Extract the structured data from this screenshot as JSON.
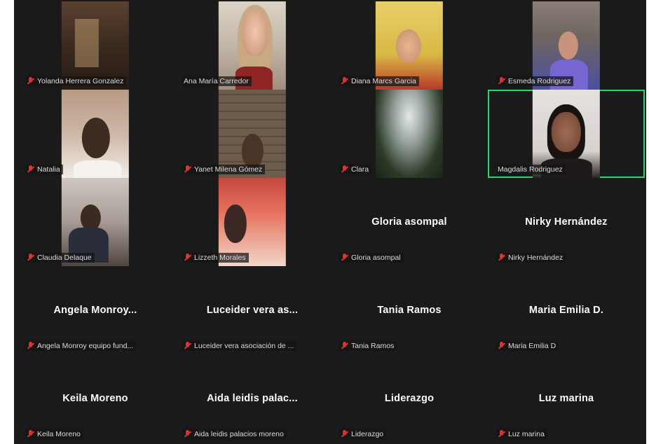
{
  "meeting": {
    "participants": [
      {
        "name": "Yolanda Herrera Gonzalez",
        "display": "",
        "video": "room",
        "muted": true
      },
      {
        "name": "Ana María Carredor",
        "display": "",
        "video": "office",
        "muted": false
      },
      {
        "name": "Diana Marcs Garcia",
        "display": "",
        "video": "yellow",
        "muted": true
      },
      {
        "name": "Esmeda Rodriguez",
        "display": "",
        "video": "blue",
        "muted": true
      },
      {
        "name": "Natalia",
        "display": "",
        "video": "natalia",
        "muted": true
      },
      {
        "name": "Yanet Milena Gómez",
        "display": "",
        "video": "brick",
        "muted": true
      },
      {
        "name": "Clara",
        "display": "",
        "video": "tree",
        "muted": true
      },
      {
        "name": "Magdalis Rodriguez",
        "display": "",
        "video": "magda",
        "muted": false,
        "active_speaker": true
      },
      {
        "name": "Claudia Delaque",
        "display": "",
        "video": "claudia",
        "muted": true
      },
      {
        "name": "Lizzeth Morales",
        "display": "",
        "video": "laura",
        "muted": true
      },
      {
        "name": "Gloria asompal",
        "display": "Gloria asompal",
        "video": "",
        "muted": true
      },
      {
        "name": "Nirky Hernández",
        "display": "Nirky Hernández",
        "video": "",
        "muted": true
      },
      {
        "name": "Angela Monroy equipo fund...",
        "display": "Angela  Monroy...",
        "video": "",
        "muted": true
      },
      {
        "name": "Luceider vera asociación de ...",
        "display": "Luceider vera as...",
        "video": "",
        "muted": true
      },
      {
        "name": "Tania Ramos",
        "display": "Tania Ramos",
        "video": "",
        "muted": true
      },
      {
        "name": "Maria Emilia D",
        "display": "Maria Emilia D.",
        "video": "",
        "muted": true
      },
      {
        "name": "Keila Moreno",
        "display": "Keila Moreno",
        "video": "",
        "muted": true
      },
      {
        "name": "Aida leidis palacios moreno",
        "display": "Aida leidis palac...",
        "video": "",
        "muted": true
      },
      {
        "name": "Liderazgo",
        "display": "Liderazgo",
        "video": "",
        "muted": true
      },
      {
        "name": "Luz marina",
        "display": "Luz marina",
        "video": "",
        "muted": true
      }
    ]
  },
  "colors": {
    "background": "#1a1a1a",
    "active_speaker_border": "#23d96b",
    "muted_icon": "#e0312b"
  },
  "icons": {
    "muted": "microphone-muted-icon"
  }
}
